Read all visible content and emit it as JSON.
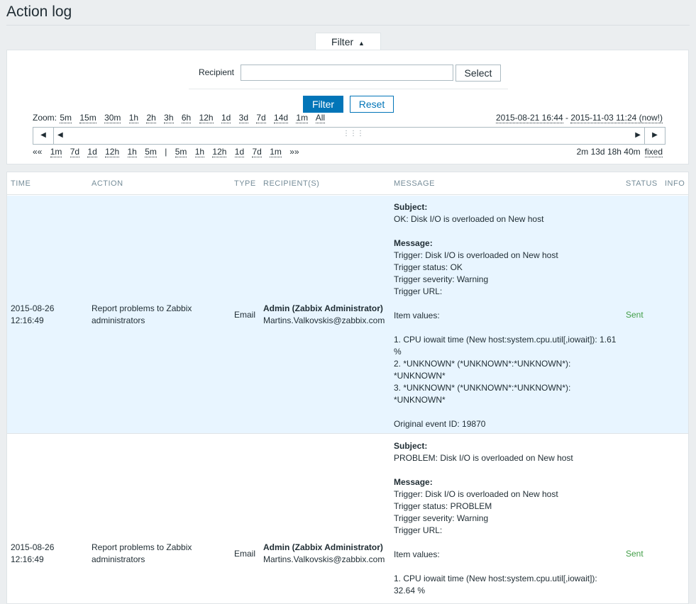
{
  "page": {
    "title": "Action log"
  },
  "filter": {
    "tab_label": "Filter",
    "tab_icon": "triangle-up-icon",
    "recipient_label": "Recipient",
    "recipient_value": "",
    "select_label": "Select",
    "filter_label": "Filter",
    "reset_label": "Reset",
    "zoom_label": "Zoom:",
    "zoom_options": [
      "5m",
      "15m",
      "30m",
      "1h",
      "2h",
      "3h",
      "6h",
      "12h",
      "1d",
      "3d",
      "7d",
      "14d",
      "1m",
      "All"
    ],
    "period_from": "2015-08-21 16:44",
    "period_sep": " - ",
    "period_to": "2015-11-03 11:24 (now!)",
    "nav_back_all": "««",
    "nav_back": [
      "1m",
      "7d",
      "1d",
      "12h",
      "1h",
      "5m"
    ],
    "nav_sep": "|",
    "nav_fwd": [
      "5m",
      "1h",
      "12h",
      "1d",
      "7d",
      "1m"
    ],
    "nav_fwd_all": "»»",
    "elapsed": "2m 13d 18h 40m",
    "fixed_label": "fixed"
  },
  "table": {
    "headers": [
      "TIME",
      "ACTION",
      "TYPE",
      "RECIPIENT(S)",
      "MESSAGE",
      "STATUS",
      "INFO"
    ],
    "rows": [
      {
        "time_date": "2015-08-26",
        "time_clock": "12:16:49",
        "action_line1": "Report problems to Zabbix",
        "action_line2": "administrators",
        "type": "Email",
        "recipient_name": "Admin (Zabbix Administrator)",
        "recipient_email": "Martins.Valkovskis@zabbix.com",
        "status": "Sent",
        "message": {
          "subject_label": "Subject:",
          "subject": "OK: Disk I/O is overloaded on New host",
          "message_label": "Message:",
          "trigger": "Trigger: Disk I/O is overloaded on New host",
          "trigger_status": "Trigger status: OK",
          "trigger_severity": "Trigger severity: Warning",
          "trigger_url": "Trigger URL:",
          "item_values": "Item values:",
          "item1_a": "1. CPU iowait time (New host:system.cpu.util[,iowait]): 1.61",
          "item1_b": "%",
          "item2_a": "2. *UNKNOWN* (*UNKNOWN*:*UNKNOWN*):",
          "item2_b": "*UNKNOWN*",
          "item3_a": "3. *UNKNOWN* (*UNKNOWN*:*UNKNOWN*):",
          "item3_b": "*UNKNOWN*",
          "original_event": "Original event ID: 19870"
        }
      },
      {
        "time_date": "2015-08-26",
        "time_clock": "12:16:49",
        "action_line1": "Report problems to Zabbix",
        "action_line2": "administrators",
        "type": "Email",
        "recipient_name": "Admin (Zabbix Administrator)",
        "recipient_email": "Martins.Valkovskis@zabbix.com",
        "status": "Sent",
        "message": {
          "subject_label": "Subject:",
          "subject": "PROBLEM: Disk I/O is overloaded on New host",
          "message_label": "Message:",
          "trigger": "Trigger: Disk I/O is overloaded on New host",
          "trigger_status": "Trigger status: PROBLEM",
          "trigger_severity": "Trigger severity: Warning",
          "trigger_url": "Trigger URL:",
          "item_values": "Item values:",
          "item1_a": "1. CPU iowait time (New host:system.cpu.util[,iowait]):",
          "item1_b": "32.64 %"
        }
      }
    ]
  },
  "colors": {
    "accent": "#0275b8",
    "status_sent": "#429e47",
    "row_highlight": "#e8f5ff"
  }
}
